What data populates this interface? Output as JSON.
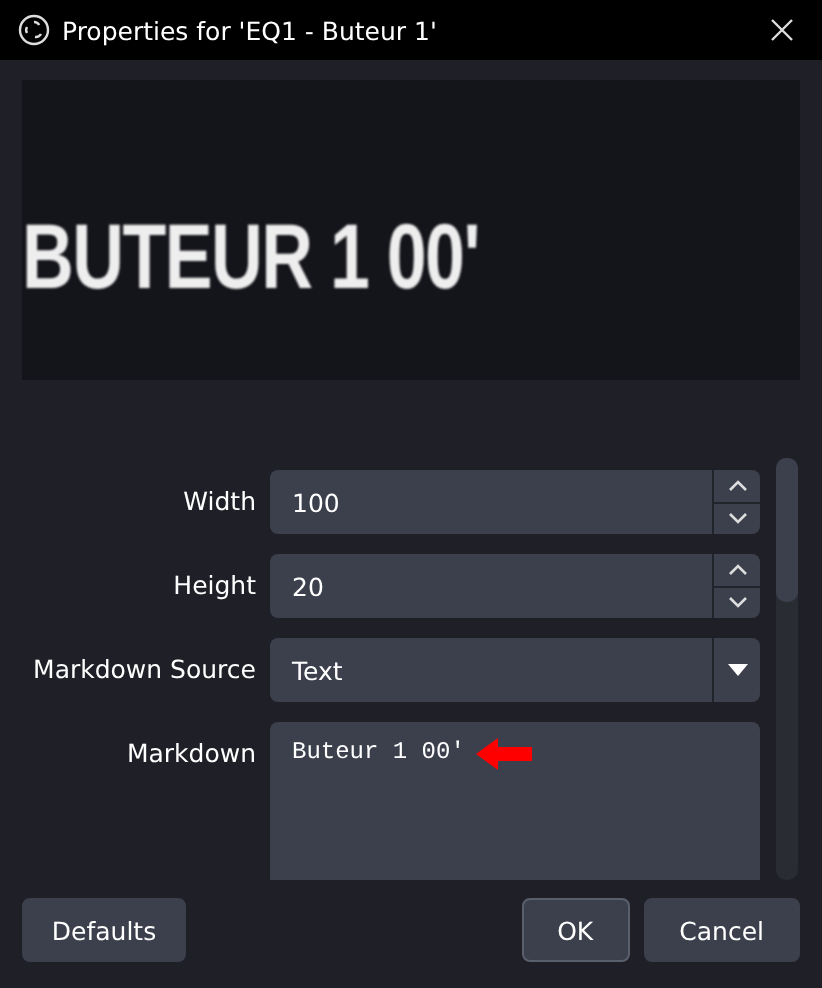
{
  "window": {
    "title": "Properties for 'EQ1 - Buteur 1'"
  },
  "preview": {
    "text": "BUTEUR 1 00'"
  },
  "properties": [
    {
      "kind": "spin",
      "label": "Width",
      "value": "100"
    },
    {
      "kind": "spin",
      "label": "Height",
      "value": "20"
    },
    {
      "kind": "dropdown",
      "label": "Markdown Source",
      "value": "Text"
    },
    {
      "kind": "textarea",
      "label": "Markdown",
      "value": "Buteur 1 00'"
    }
  ],
  "buttons": [
    {
      "label": "Defaults",
      "kind": "left",
      "selected": false
    },
    {
      "label": "OK",
      "kind": "right",
      "selected": true
    },
    {
      "label": "Cancel",
      "kind": "right",
      "selected": false
    }
  ]
}
